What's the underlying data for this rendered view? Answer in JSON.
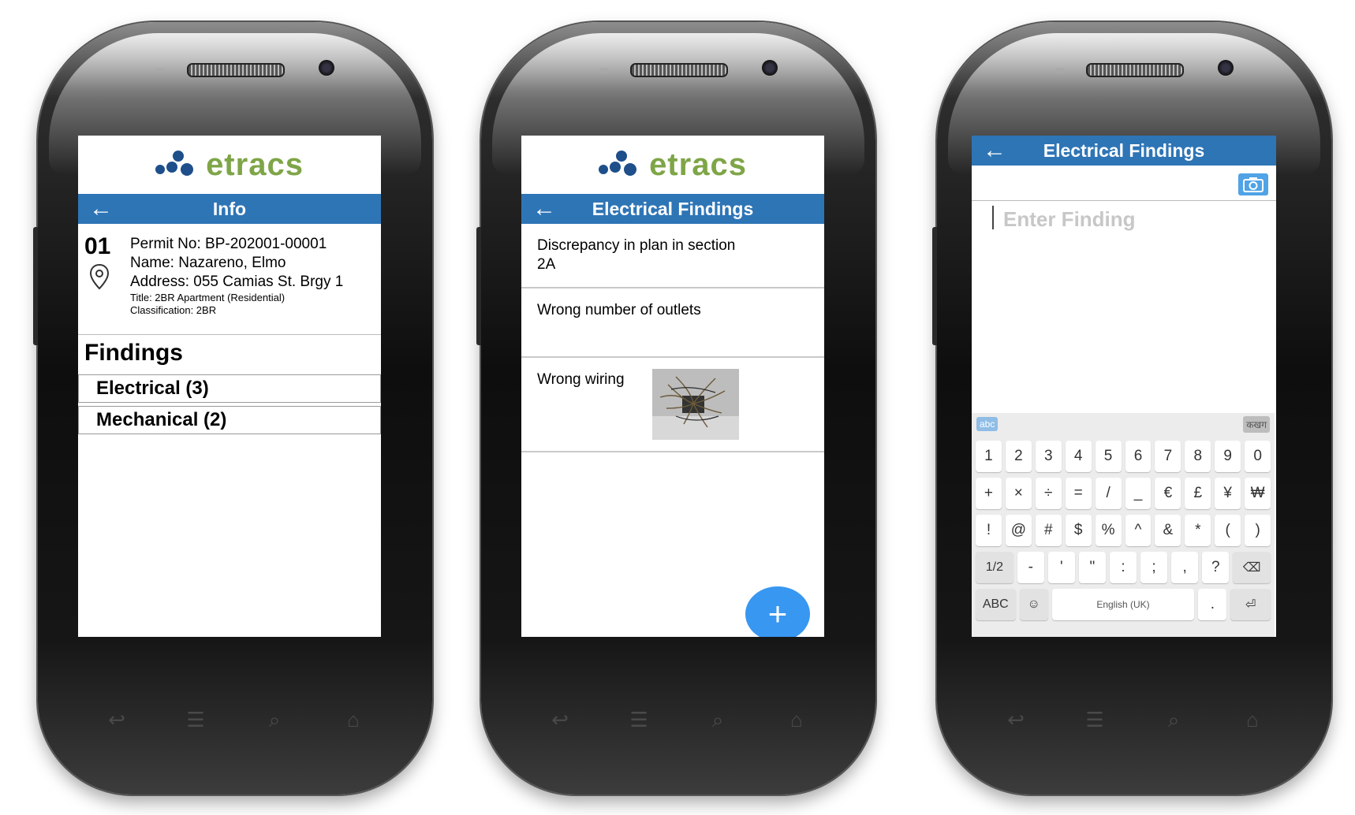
{
  "brand": {
    "name": "etracs",
    "logo_blue": "#1e4f8a",
    "logo_green": "#7ea547",
    "accent": "#2e75b6"
  },
  "phone1": {
    "header": "Info",
    "record": {
      "number": "01",
      "permit": "Permit No: BP-202001-00001",
      "name": "Name: Nazareno, Elmo",
      "address": "Address: 055 Camias St. Brgy 1",
      "title": "Title: 2BR Apartment (Residential)",
      "classification": "Classification: 2BR"
    },
    "findings_title": "Findings",
    "categories": [
      {
        "label": "Electrical (3)"
      },
      {
        "label": "Mechanical (2)"
      }
    ]
  },
  "phone2": {
    "header": "Electrical Findings",
    "items": [
      {
        "text": "Discrepancy in plan in section 2A"
      },
      {
        "text": "Wrong number of outlets"
      },
      {
        "text": "Wrong wiring",
        "has_photo": true
      }
    ],
    "fab": "+"
  },
  "phone3": {
    "header": "Electrical Findings",
    "placeholder": "Enter Finding",
    "keyboard": {
      "mode_left": "abc",
      "mode_right": "कखग",
      "row1": [
        "1",
        "2",
        "3",
        "4",
        "5",
        "6",
        "7",
        "8",
        "9",
        "0"
      ],
      "row2": [
        "+",
        "×",
        "÷",
        "=",
        "/",
        "_",
        "€",
        "£",
        "¥",
        "₩"
      ],
      "row3": [
        "!",
        "@",
        "#",
        "$",
        "%",
        "^",
        "&",
        "*",
        "(",
        ")"
      ],
      "row4": [
        "1/2",
        "-",
        "'",
        "\"",
        ":",
        ";",
        ",",
        "?",
        "⌫"
      ],
      "row5": [
        "ABC",
        "☺",
        "English (UK)",
        ".",
        "⏎"
      ]
    }
  }
}
